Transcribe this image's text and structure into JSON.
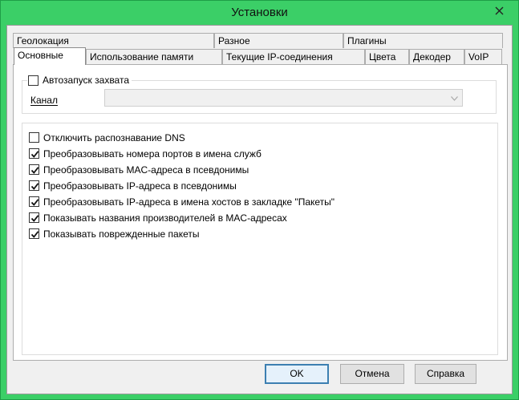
{
  "window": {
    "title": "Установки"
  },
  "tabs_row1": [
    {
      "label": "Геолокация"
    },
    {
      "label": "Разное"
    },
    {
      "label": "Плагины"
    }
  ],
  "tabs_row2": [
    {
      "label": "Основные",
      "active": true
    },
    {
      "label": "Использование памяти"
    },
    {
      "label": "Текущие IP-соединения"
    },
    {
      "label": "Цвета"
    },
    {
      "label": "Декодер"
    },
    {
      "label": "VoIP"
    }
  ],
  "autostart": {
    "label": "Автозапуск захвата",
    "checked": false,
    "channel_label": "Канал",
    "channel_value": ""
  },
  "options": [
    {
      "label": "Отключить распознавание DNS",
      "checked": false
    },
    {
      "label": "Преобразовывать номера портов в имена служб",
      "checked": true
    },
    {
      "label": "Преобразовывать MAC-адреса в псевдонимы",
      "checked": true
    },
    {
      "label": "Преобразовывать IP-адреса в псевдонимы",
      "checked": true
    },
    {
      "label": "Преобразовывать IP-адреса в имена хостов в закладке \"Пакеты\"",
      "checked": true
    },
    {
      "label": "Показывать названия производителей в MAC-адресах",
      "checked": true
    },
    {
      "label": "Показывать поврежденные пакеты",
      "checked": true
    }
  ],
  "buttons": {
    "ok": "OK",
    "cancel": "Отмена",
    "help": "Справка"
  },
  "colors": {
    "titlebar": "#3bcf67",
    "accent": "#3c7fb1"
  }
}
